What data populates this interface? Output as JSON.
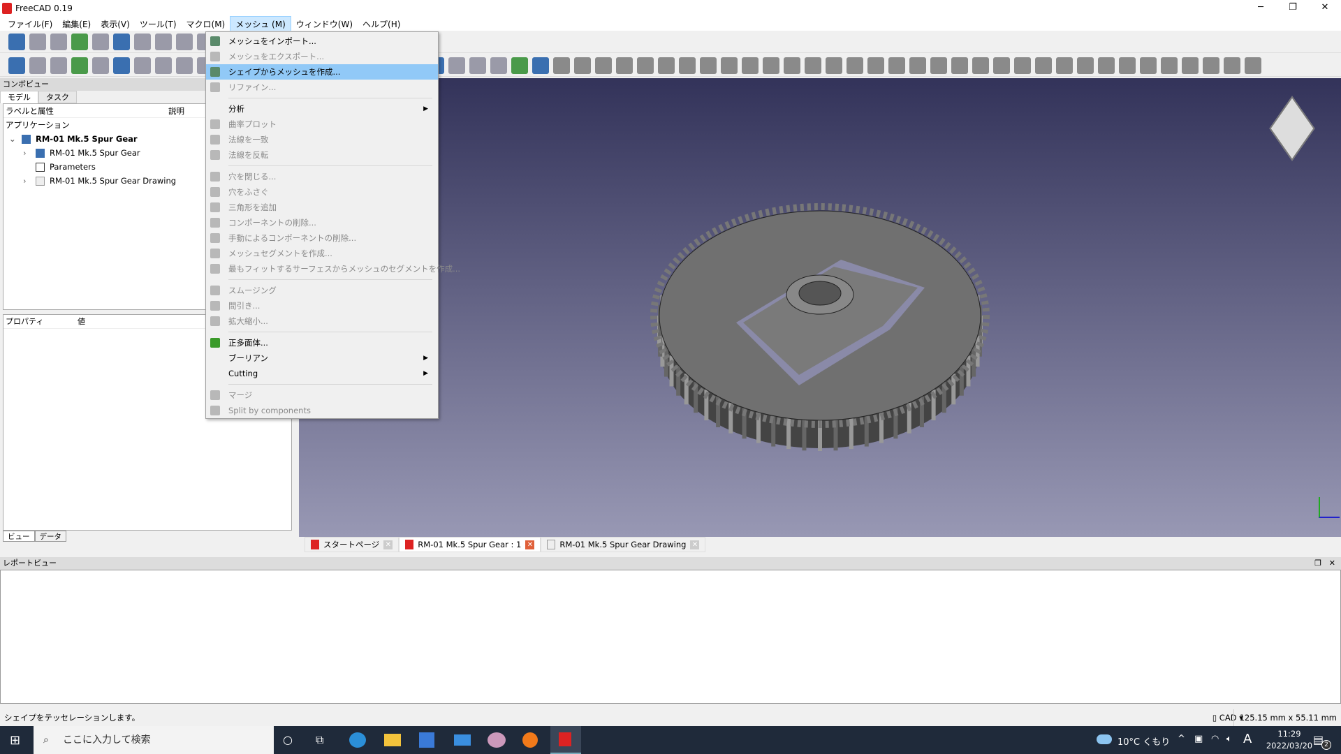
{
  "app": {
    "title": "FreeCAD 0.19"
  },
  "menubar": [
    "ファイル(F)",
    "編集(E)",
    "表示(V)",
    "ツール(T)",
    "マクロ(M)",
    "メッシュ (M)",
    "ウィンドウ(W)",
    "ヘルプ(H)"
  ],
  "combo": {
    "title": "コンボビュー",
    "tabs": [
      "モデル",
      "タスク"
    ],
    "col_label": "ラベルと属性",
    "col_desc": "説明",
    "app_label": "アプリケーション",
    "tree": [
      {
        "label": "RM-01 Mk.5 Spur Gear",
        "level": 0,
        "bold": true
      },
      {
        "label": "RM-01 Mk.5 Spur Gear",
        "level": 1
      },
      {
        "label": "Parameters",
        "level": 1
      },
      {
        "label": "RM-01 Mk.5 Spur Gear Drawing",
        "level": 1
      }
    ],
    "prop_col": "プロパティ",
    "value_col": "値",
    "bottom_tabs": [
      "ビュー",
      "データ"
    ]
  },
  "mesh_menu": [
    {
      "label": "メッシュをインポート...",
      "enabled": true,
      "icon": "import-mesh-icon"
    },
    {
      "label": "メッシュをエクスポート...",
      "enabled": false,
      "icon": "export-mesh-icon"
    },
    {
      "label": "シェイプからメッシュを作成...",
      "enabled": true,
      "highlighted": true,
      "icon": "mesh-from-shape-icon"
    },
    {
      "label": "リファイン...",
      "enabled": false,
      "icon": "refine-icon"
    },
    {
      "sep": true
    },
    {
      "label": "分析",
      "enabled": true,
      "submenu": true
    },
    {
      "label": "曲率プロット",
      "enabled": false,
      "icon": "curvature-icon"
    },
    {
      "label": "法線を一致",
      "enabled": false,
      "icon": "harmonize-normals-icon"
    },
    {
      "label": "法線を反転",
      "enabled": false,
      "icon": "flip-normals-icon"
    },
    {
      "sep": true
    },
    {
      "label": "穴を閉じる...",
      "enabled": false,
      "icon": "fill-holes-icon"
    },
    {
      "label": "穴をふさぐ",
      "enabled": false,
      "icon": "fill-interactive-hole-icon"
    },
    {
      "label": "三角形を追加",
      "enabled": false,
      "icon": "add-facet-icon"
    },
    {
      "label": "コンポーネントの削除...",
      "enabled": false,
      "icon": "remove-components-icon"
    },
    {
      "label": "手動によるコンポーネントの削除...",
      "enabled": false,
      "icon": "remove-comp-by-hand-icon"
    },
    {
      "label": "メッシュセグメントを作成...",
      "enabled": false,
      "icon": "segmentation-icon"
    },
    {
      "label": "最もフィットするサーフェスからメッシュのセグメントを作成...",
      "enabled": false,
      "icon": "segment-best-fit-icon"
    },
    {
      "sep": true
    },
    {
      "label": "スムージング",
      "enabled": false,
      "icon": "smoothing-icon"
    },
    {
      "label": "間引き...",
      "enabled": false,
      "icon": "decimating-icon"
    },
    {
      "label": "拡大縮小...",
      "enabled": false,
      "icon": "scale-icon"
    },
    {
      "sep": true
    },
    {
      "label": "正多面体...",
      "enabled": true,
      "icon": "regular-solid-icon"
    },
    {
      "label": "ブーリアン",
      "enabled": true,
      "submenu": true
    },
    {
      "label": "Cutting",
      "enabled": true,
      "submenu": true
    },
    {
      "sep": true
    },
    {
      "label": "マージ",
      "enabled": false,
      "icon": "merge-icon"
    },
    {
      "label": "Split by components",
      "enabled": false,
      "icon": "split-components-icon"
    }
  ],
  "doc_tabs": [
    {
      "label": "スタートページ"
    },
    {
      "label": "RM-01 Mk.5 Spur Gear : 1",
      "selected": true
    },
    {
      "label": "RM-01 Mk.5 Spur Gear Drawing"
    }
  ],
  "report": {
    "title": "レポートビュー"
  },
  "status": {
    "message": "シェイプをテッセレーションします。",
    "nav_style": "CAD",
    "dimensions": "125.15 mm x 55.11 mm"
  },
  "taskbar": {
    "search_placeholder": "ここに入力して検索",
    "weather": "10°C くもり",
    "ime": "A",
    "time": "11:29",
    "date": "2022/03/20",
    "notifications": "2"
  },
  "colors": {
    "highlight": "#91c9f7",
    "view_top": "#33335a",
    "view_bottom": "#9898b4"
  }
}
